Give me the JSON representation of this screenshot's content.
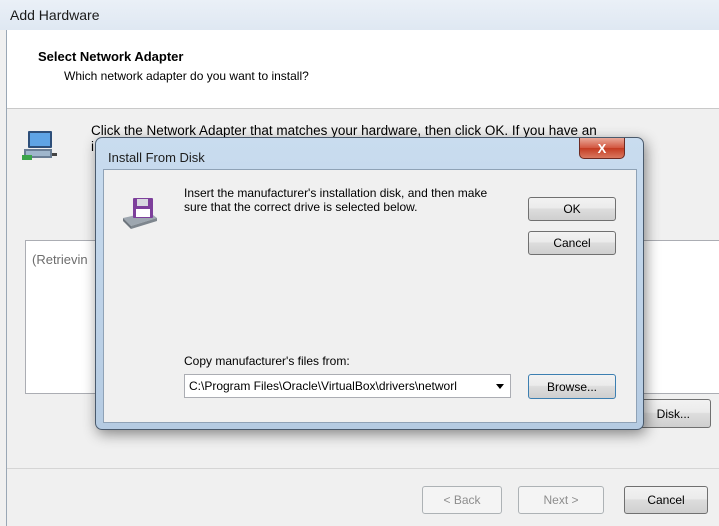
{
  "window": {
    "title": "Add Hardware"
  },
  "header": {
    "title": "Select Network Adapter",
    "subtitle": "Which network adapter do you want to install?"
  },
  "instruction": {
    "line1": "Click the Network Adapter that matches your hardware, then click OK. If you have an",
    "line2_fragment": "i"
  },
  "listbox": {
    "status": "(Retrievin"
  },
  "have_disk_label": "Disk...",
  "nav": {
    "back": "< Back",
    "next": "Next >",
    "cancel": "Cancel"
  },
  "dialog": {
    "title": "Install From Disk",
    "close_glyph": "X",
    "message": "Insert the manufacturer's installation disk, and then make sure that the correct drive is selected below.",
    "ok": "OK",
    "cancel": "Cancel",
    "copy_label": "Copy manufacturer's files from:",
    "path_value": "C:\\Program Files\\Oracle\\VirtualBox\\drivers\\networl",
    "browse": "Browse..."
  },
  "icons": {
    "network": "network-adapter-icon",
    "disk": "floppy-disk-drive-icon"
  }
}
